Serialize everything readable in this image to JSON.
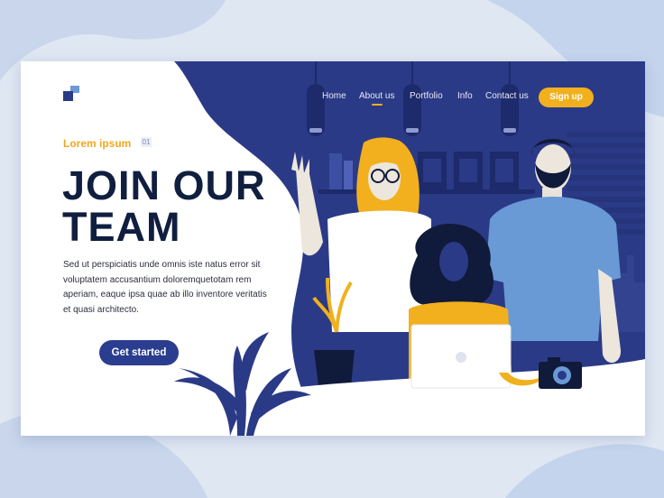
{
  "brand": {
    "logo": "squares-logo-icon"
  },
  "nav": {
    "items": [
      {
        "label": "Home"
      },
      {
        "label": "About us",
        "active": true
      },
      {
        "label": "Portfolio"
      },
      {
        "label": "Info"
      },
      {
        "label": "Contact us"
      }
    ],
    "signup_label": "Sign up"
  },
  "hero": {
    "eyebrow": "Lorem ipsum",
    "eyebrow_number": "01",
    "headline_line1": "JOIN OUR",
    "headline_line2": "TEAM",
    "body_line1": "Sed ut perspiciatis unde omnis iste natus error sit",
    "body_line2": "voluptatem accusantium doloremquetotam rem",
    "body_line3": "aperiam, eaque ipsa quae ab illo inventore veritatis",
    "body_line4": "et quasi architecto.",
    "cta_label": "Get started"
  },
  "colors": {
    "navy": "#2b3a86",
    "dark_navy": "#1d2a6b",
    "yellow": "#f2b01e",
    "light_blue": "#6b9ad8",
    "headline": "#101f3f",
    "page_bg": "#dbe4f1"
  }
}
